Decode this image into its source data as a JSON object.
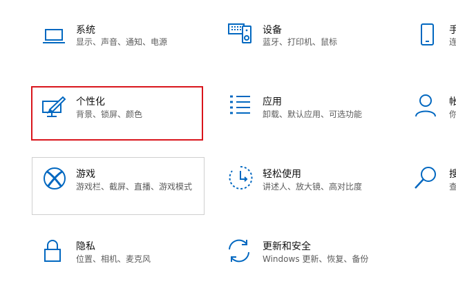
{
  "tiles": [
    {
      "id": "system",
      "title": "系统",
      "desc": "显示、声音、通知、电源",
      "icon": "laptop-icon"
    },
    {
      "id": "devices",
      "title": "设备",
      "desc": "蓝牙、打印机、鼠标",
      "icon": "keyboard-speaker-icon"
    },
    {
      "id": "phone",
      "title": "手",
      "desc": "连",
      "icon": "phone-icon"
    },
    {
      "id": "personalization",
      "title": "个性化",
      "desc": "背景、锁屏、颜色",
      "icon": "paint-monitor-icon"
    },
    {
      "id": "apps",
      "title": "应用",
      "desc": "卸载、默认应用、可选功能",
      "icon": "apps-list-icon"
    },
    {
      "id": "accounts",
      "title": "帐",
      "desc": "你",
      "icon": "person-icon"
    },
    {
      "id": "gaming",
      "title": "游戏",
      "desc": "游戏栏、截屏、直播、游戏模式",
      "icon": "xbox-icon"
    },
    {
      "id": "ease",
      "title": "轻松使用",
      "desc": "讲述人、放大镜、高对比度",
      "icon": "ease-of-access-icon"
    },
    {
      "id": "search",
      "title": "搜",
      "desc": "查",
      "icon": "search-icon"
    },
    {
      "id": "privacy",
      "title": "隐私",
      "desc": "位置、相机、麦克风",
      "icon": "lock-icon"
    },
    {
      "id": "update",
      "title": "更新和安全",
      "desc": "Windows 更新、恢复、备份",
      "icon": "sync-icon"
    }
  ],
  "colors": {
    "accent": "#0067c0",
    "highlight": "#d9141b"
  }
}
